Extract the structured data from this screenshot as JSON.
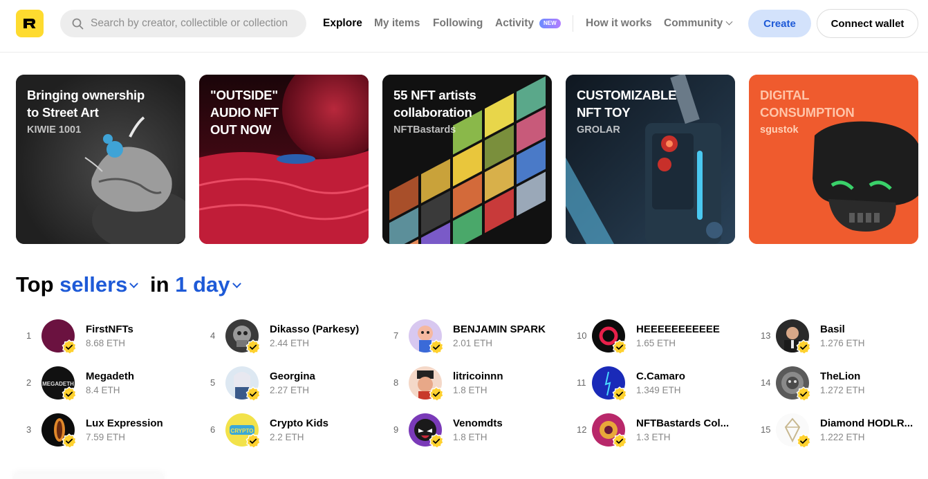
{
  "header": {
    "logo_icon": "rarible-logo-icon",
    "search_placeholder": "Search by creator, collectible or collection",
    "nav": {
      "explore": "Explore",
      "my_items": "My items",
      "following": "Following",
      "activity": "Activity",
      "activity_badge": "NEW",
      "how_it_works": "How it works",
      "community": "Community"
    },
    "create_label": "Create",
    "connect_label": "Connect wallet",
    "colors": {
      "brand_yellow": "#fedb2f",
      "accent_blue": "#1e5ad7",
      "create_bg": "#d3e2fb"
    }
  },
  "banners": [
    {
      "title": "Bringing ownership\nto Street Art",
      "subtitle": "KIWIE 1001",
      "bg": "#2a2a2a"
    },
    {
      "title": "\"OUTSIDE\"\nAUDIO NFT\nOUT NOW",
      "subtitle": "",
      "bg": "#7a0f22"
    },
    {
      "title": "55 NFT artists\ncollaboration",
      "subtitle": "NFTBastards",
      "bg": "#111111"
    },
    {
      "title": "CUSTOMIZABLE\nNFT TOY",
      "subtitle": "GROLAR",
      "bg": "#1d2b3a"
    },
    {
      "title": "DIGITAL\nCONSUMPTION",
      "subtitle": "sgustok",
      "bg": "#ee5a2e"
    }
  ],
  "top_sellers": {
    "heading_prefix": "Top",
    "heading_category": "sellers",
    "heading_in": "in",
    "heading_period": "1 day",
    "sellers": [
      {
        "rank": "1",
        "name": "FirstNFTs",
        "eth": "8.68 ETH"
      },
      {
        "rank": "2",
        "name": "Megadeth",
        "eth": "8.4 ETH"
      },
      {
        "rank": "3",
        "name": "Lux Expression",
        "eth": "7.59 ETH"
      },
      {
        "rank": "4",
        "name": "Dikasso (Parkesy)",
        "eth": "2.44 ETH"
      },
      {
        "rank": "5",
        "name": "Georgina",
        "eth": "2.27 ETH"
      },
      {
        "rank": "6",
        "name": "Crypto Kids",
        "eth": "2.2 ETH"
      },
      {
        "rank": "7",
        "name": "BENJAMIN SPARK",
        "eth": "2.01 ETH"
      },
      {
        "rank": "8",
        "name": "litricoinnn",
        "eth": "1.8 ETH"
      },
      {
        "rank": "9",
        "name": "Venomdts",
        "eth": "1.8 ETH"
      },
      {
        "rank": "10",
        "name": "HEEEEEEEEEEE",
        "eth": "1.65 ETH"
      },
      {
        "rank": "11",
        "name": "C.Camaro",
        "eth": "1.349 ETH"
      },
      {
        "rank": "12",
        "name": "NFTBastards Col...",
        "eth": "1.3 ETH"
      },
      {
        "rank": "13",
        "name": "Basil",
        "eth": "1.276 ETH"
      },
      {
        "rank": "14",
        "name": "TheLion",
        "eth": "1.272 ETH"
      },
      {
        "rank": "15",
        "name": "Diamond HODLR...",
        "eth": "1.222 ETH"
      }
    ]
  }
}
